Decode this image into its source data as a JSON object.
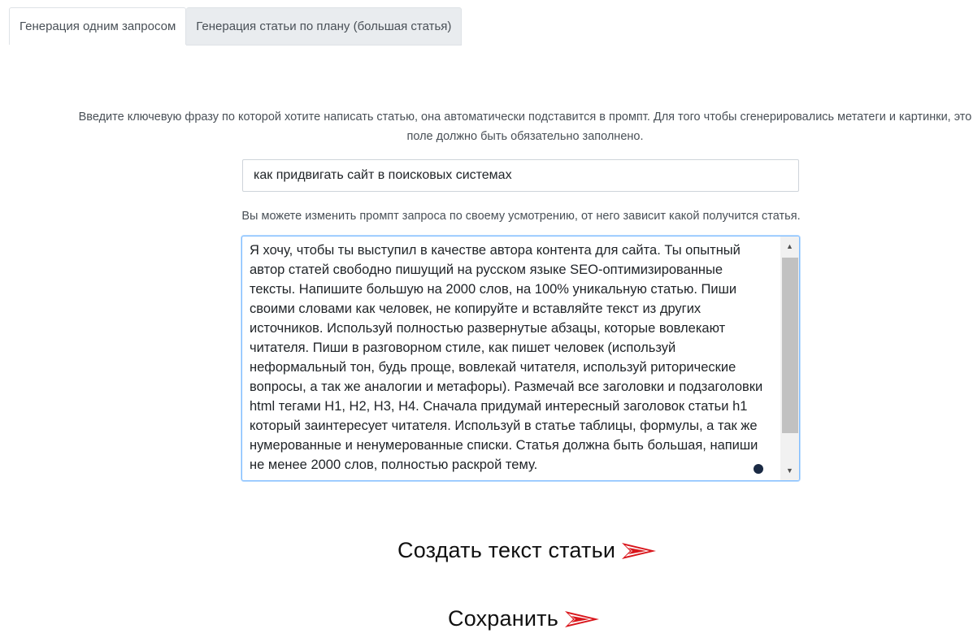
{
  "tabs": [
    {
      "label": "Генерация одним запросом",
      "active": true
    },
    {
      "label": "Генерация статьи по плану (большая статья)",
      "active": false
    }
  ],
  "keyword_hint": "Введите ключевую фразу по которой хотите написать статью, она автоматически подставится в промпт. Для того чтобы сгенерировались метатеги и картинки, это поле должно быть обязательно заполнено.",
  "keyword_value": "как придвигать сайт в поисковых системах",
  "prompt_hint": "Вы можете изменить промпт запроса по своему усмотрению, от него зависит какой получится статья.",
  "prompt_text": "Я хочу, чтобы ты выступил в качестве автора контента для сайта. Ты опытный\nавтор статей свободно пишущий на русском языке SEO-оптимизированные\nтексты. Напишите большую на 2000 слов, на 100% уникальную статью. Пиши\nсвоими словами как человек, не копируйте и вставляйте текст из других\nисточников. Используй полностью развернутые абзацы, которые вовлекают\nчитателя. Пиши в разговорном стиле, как пишет человек (используй\nнеформальный тон, будь проще, вовлекай читателя, используй риторические\nвопросы, а так же аналогии и метафоры). Размечай все заголовки и подзаголовки\nhtml тегами H1, H2, H3, H4. Сначала придумай интересный заголовок статьи h1\nкоторый заинтересует читателя. Используй в статье таблицы, формулы, а так же\nнумерованные и ненумерованные списки. Статья должна быть большая, напиши\nне менее 2000 слов, полностью раскрой тему.",
  "actions": {
    "create_label": "Создать текст статьи",
    "save_label": "Сохранить"
  },
  "colors": {
    "arrow": "#d9161c",
    "focus_border": "#80bdff",
    "inactive_tab": "#e9ecef"
  },
  "icons": {
    "arrow": "red-paper-plane-arrow-icon"
  }
}
